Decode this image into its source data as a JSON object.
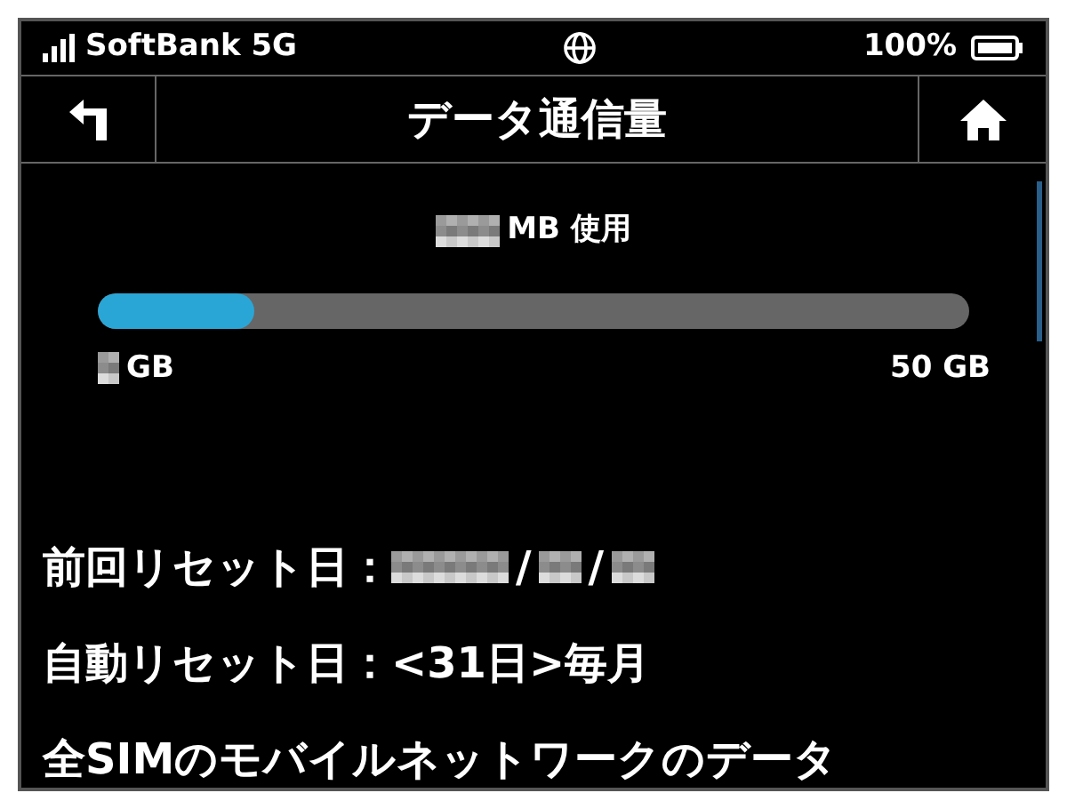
{
  "status_bar": {
    "carrier": "SoftBank 5G",
    "battery": "100%"
  },
  "header": {
    "title": "データ通信量"
  },
  "usage": {
    "amount_unit": "MB 使用",
    "level": 0.18,
    "min_label_unit": "GB",
    "max_label": "50 GB"
  },
  "info_lines": [
    {
      "label": "前回リセット日：",
      "value": "/",
      "value2": "/"
    },
    {
      "label": "自動リセット日：",
      "value": "<31日>毎月"
    },
    {
      "label": "全SIMのモバイルネットワークのデータ"
    }
  ]
}
